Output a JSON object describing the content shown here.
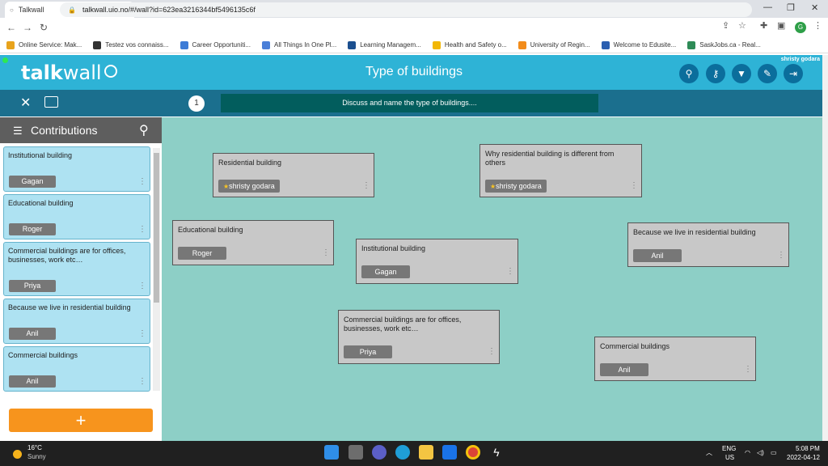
{
  "browser": {
    "tab_title": "Talkwall",
    "tab_close": "✕",
    "new_tab": "+",
    "url": "talkwall.uio.no/#/wall?id=623ea3216344bf5496135c6f",
    "profile_initial": "G",
    "bookmarks": [
      {
        "label": "Online Service: Mak...",
        "color": "#e8a31c"
      },
      {
        "label": "Testez vos connaiss...",
        "color": "#333333"
      },
      {
        "label": "Career Opportuniti...",
        "color": "#3c7bd6"
      },
      {
        "label": "All Things In One Pl...",
        "color": "#4a7fd8"
      },
      {
        "label": "Learning Managem...",
        "color": "#1b4f8f"
      },
      {
        "label": "Health and Safety o...",
        "color": "#f2b705"
      },
      {
        "label": "University of Regin...",
        "color": "#f28c1b"
      },
      {
        "label": "Welcome to Edusite...",
        "color": "#2b5fb0"
      },
      {
        "label": "SaskJobs.ca - Real...",
        "color": "#2e8b57"
      }
    ]
  },
  "app": {
    "logo_bold": "talk",
    "logo_light": "wall",
    "wall_title": "Type of buildings",
    "user_name": "shristy godara",
    "question_number": "1",
    "question_text": "Discuss and name the type of buildings...."
  },
  "sidebar": {
    "title": "Contributions",
    "cards": [
      {
        "text": "Institutional building",
        "author": "Gagan"
      },
      {
        "text": "Educational building",
        "author": "Roger"
      },
      {
        "text": "Commercial buildings are for offices, businesses, work etc…",
        "author": "Priya"
      },
      {
        "text": "Because we live in residential building",
        "author": "Anil"
      },
      {
        "text": "Commercial buildings",
        "author": "Anil"
      }
    ],
    "add_label": "+"
  },
  "wall_notes": [
    {
      "text": "Residential building",
      "author": "shristy godara",
      "starred": true
    },
    {
      "text": "Why residential building is different from others",
      "author": "shristy godara",
      "starred": true
    },
    {
      "text": "Educational building",
      "author": "Roger",
      "starred": false
    },
    {
      "text": "Because we live in residential building",
      "author": "Anil",
      "starred": false
    },
    {
      "text": "Institutional building",
      "author": "Gagan",
      "starred": false
    },
    {
      "text": "Commercial buildings are for offices, businesses, work etc…",
      "author": "Priya",
      "starred": false
    },
    {
      "text": "Commercial buildings",
      "author": "Anil",
      "starred": false
    }
  ],
  "taskbar": {
    "temp": "16°C",
    "weather": "Sunny",
    "lang_top": "ENG",
    "lang_bottom": "US",
    "time": "5:08 PM",
    "date": "2022-04-12"
  },
  "colors": {
    "header": "#2eb3d6",
    "subheader": "#1b6f8e",
    "wall": "#8dcfc6",
    "note": "#c8c8c8",
    "sidebar_card": "#aee2f2",
    "add_button": "#f7941d"
  }
}
